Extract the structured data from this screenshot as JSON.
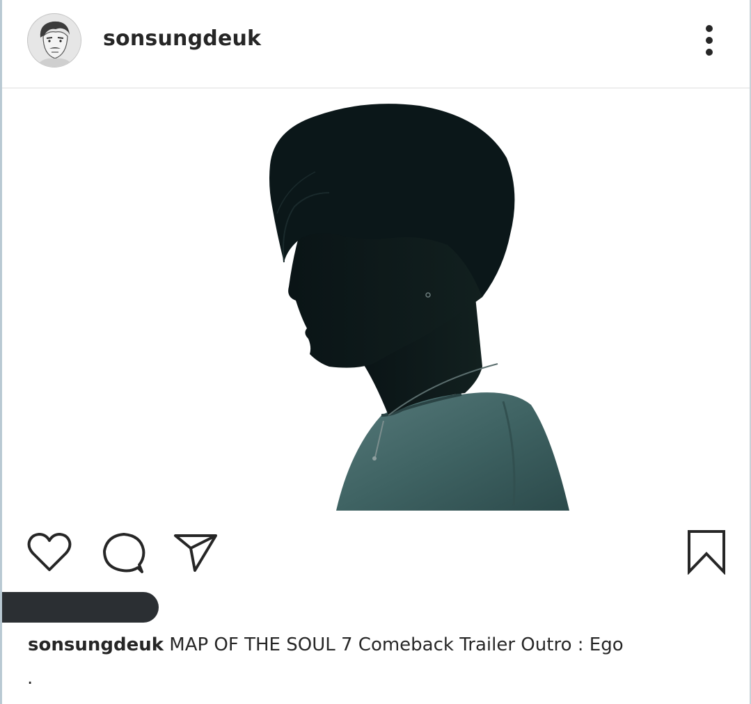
{
  "post": {
    "username": "sonsungdeuk",
    "caption_user": "sonsungdeuk",
    "caption_text": " MAP OF THE SOUL 7 Comeback Trailer Outro : Ego",
    "caption_second_line": "."
  },
  "icons": {
    "more": "more-vertical-icon",
    "like": "heart-icon",
    "comment": "comment-icon",
    "share": "send-icon",
    "save": "bookmark-icon"
  },
  "colors": {
    "text": "#262626",
    "silhouette": "#0d1b1c",
    "shirt": "#3a5a5a",
    "redaction": "#2b2f33",
    "divider": "#dcdcdc"
  }
}
